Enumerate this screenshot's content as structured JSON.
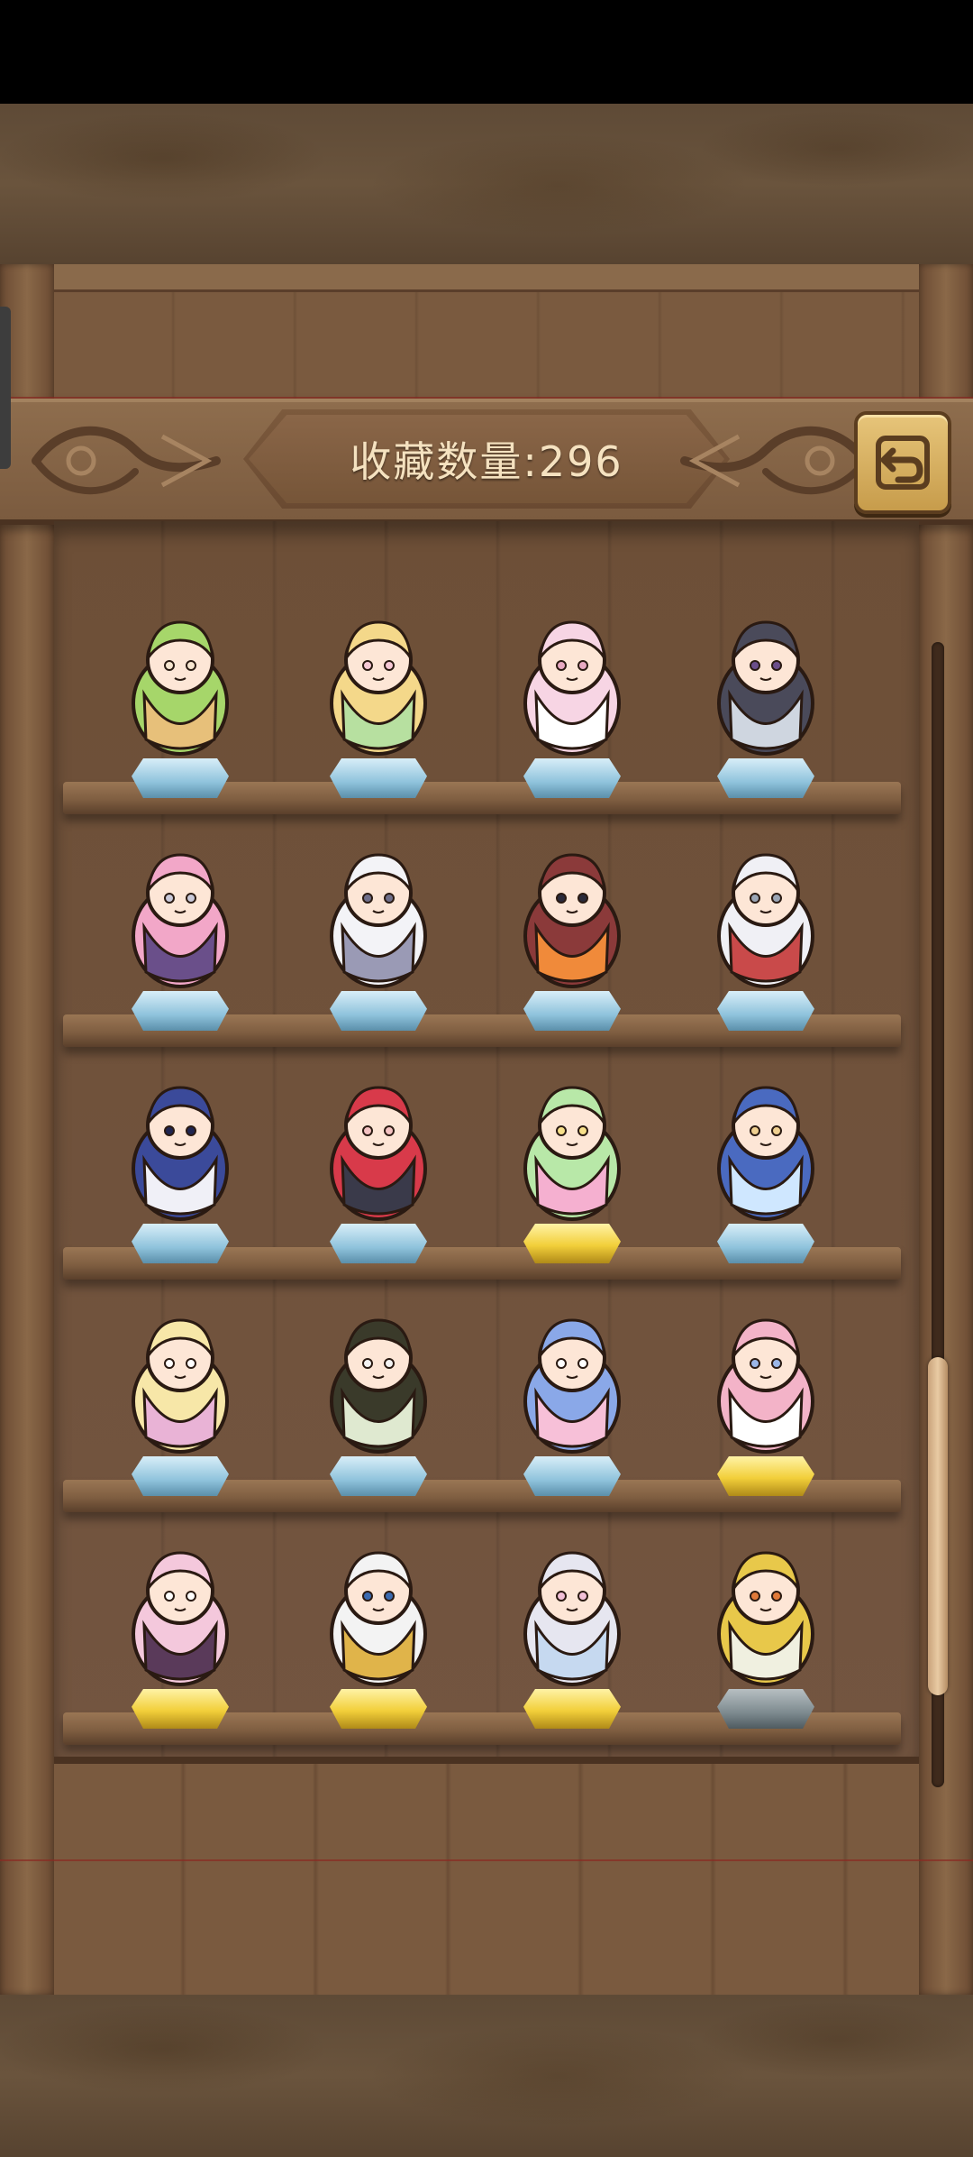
{
  "header": {
    "title": "收藏数量:296",
    "back_button_label": "back-icon"
  },
  "shelves": [
    {
      "figures": [
        {
          "name": "burger-figure",
          "base": "blue"
        },
        {
          "name": "flower-girl-figure",
          "base": "blue"
        },
        {
          "name": "pink-maid-figure",
          "base": "blue"
        },
        {
          "name": "umbrella-suitcase-figure",
          "base": "blue"
        }
      ]
    },
    {
      "figures": [
        {
          "name": "pink-knight-figure",
          "base": "blue"
        },
        {
          "name": "white-fox-figure",
          "base": "blue"
        },
        {
          "name": "book-witch-figure",
          "base": "blue"
        },
        {
          "name": "hammer-bride-figure",
          "base": "blue"
        }
      ]
    },
    {
      "figures": [
        {
          "name": "dark-wing-figure",
          "base": "blue"
        },
        {
          "name": "red-twintail-figure",
          "base": "blue"
        },
        {
          "name": "dessert-figure",
          "base": "gold"
        },
        {
          "name": "blue-catgirl-figure",
          "base": "blue"
        }
      ]
    },
    {
      "figures": [
        {
          "name": "blonde-maid-figure",
          "base": "blue"
        },
        {
          "name": "parasol-girl-figure",
          "base": "blue"
        },
        {
          "name": "magic-wand-figure",
          "base": "blue"
        },
        {
          "name": "angel-figure",
          "base": "gold"
        }
      ]
    },
    {
      "figures": [
        {
          "name": "demon-dancer-figure",
          "base": "gold"
        },
        {
          "name": "spear-catgirl-figure",
          "base": "gold"
        },
        {
          "name": "umbrella-angel-figure",
          "base": "gold"
        },
        {
          "name": "radish-girl-figure",
          "base": "grey"
        }
      ]
    }
  ],
  "scrollbar": {
    "position": 0.62
  },
  "colors": {
    "wood_dark": "#4a3221",
    "wood_mid": "#7b5a40",
    "title_text": "#f5e2c0",
    "button_gold": "#d9b062"
  }
}
